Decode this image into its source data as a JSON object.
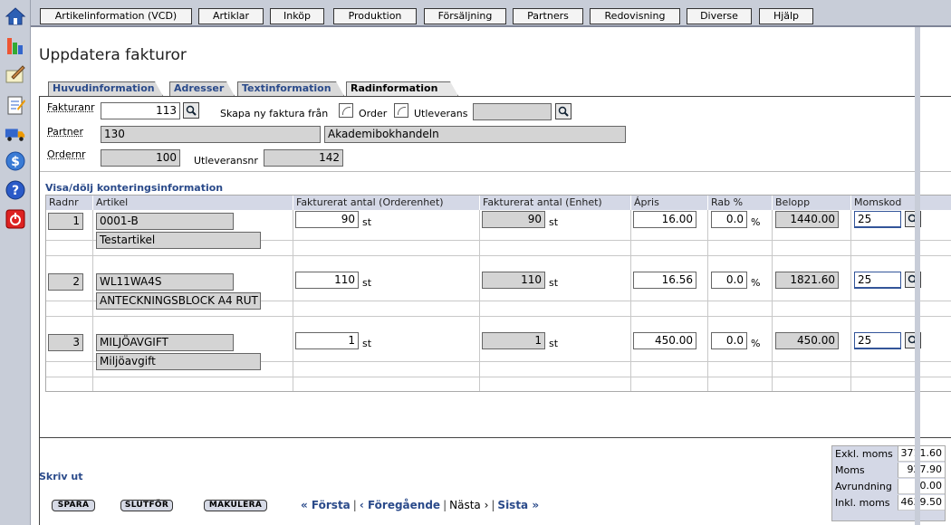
{
  "top_menu": [
    "Artikelinformation (VCD)",
    "Artiklar",
    "Inköp",
    "Produktion",
    "Försäljning",
    "Partners",
    "Redovisning",
    "Diverse",
    "Hjälp"
  ],
  "page_title": "Uppdatera fakturor",
  "sub_tabs": [
    "Huvudinformation",
    "Adresser",
    "Textinformation",
    "Radinformation"
  ],
  "header_form": {
    "fakturanr_label": "Fakturanr",
    "fakturanr_value": "113",
    "skapa_label": "Skapa ny faktura från",
    "order_label": "Order",
    "utleverans_label": "Utleverans",
    "utleverans_value": "",
    "partner_label": "Partner",
    "partner_code": "130",
    "partner_name": "Akademibokhandeln",
    "ordernr_label": "Ordernr",
    "ordernr_value": "100",
    "utleveransnr_label": "Utleveransnr",
    "utleveransnr_value": "142"
  },
  "toggle_label": "Visa/dölj konteringsinformation",
  "columns": [
    "Radnr",
    "Artikel",
    "Fakturerat antal (Orderenhet)",
    "Fakturerat antal (Enhet)",
    "Ápris",
    "Rab %",
    "Belopp",
    "Momskod"
  ],
  "rows": [
    {
      "radnr": "1",
      "artikel": "0001-B",
      "beskrivning": "Testartikel",
      "antal_order": "90",
      "unit1": "st",
      "antal_enhet": "90",
      "unit2": "st",
      "apris": "16.00",
      "rab": "0.0",
      "pct": "%",
      "belopp": "1440.00",
      "momskod": "25"
    },
    {
      "radnr": "2",
      "artikel": "WL11WA4S",
      "beskrivning": "ANTECKNINGSBLOCK A4 RUT",
      "antal_order": "110",
      "unit1": "st",
      "antal_enhet": "110",
      "unit2": "st",
      "apris": "16.56",
      "rab": "0.0",
      "pct": "%",
      "belopp": "1821.60",
      "momskod": "25"
    },
    {
      "radnr": "3",
      "artikel": "MILJÖAVGIFT",
      "beskrivning": "Miljöavgift",
      "antal_order": "1",
      "unit1": "st",
      "antal_enhet": "1",
      "unit2": "st",
      "apris": "450.00",
      "rab": "0.0",
      "pct": "%",
      "belopp": "450.00",
      "momskod": "25"
    }
  ],
  "print_label": "Skriv ut",
  "buttons": {
    "spara": "SPARA",
    "slutfor": "SLUTFÖR",
    "makulera": "MAKULERA"
  },
  "pager": {
    "forsta": "« Första",
    "foregaende": "‹ Föregående",
    "nasta": "Nästa ›",
    "sista": "Sista »",
    "sep": "|"
  },
  "totals": [
    {
      "label": "Exkl. moms",
      "value": "3711.60"
    },
    {
      "label": "Moms",
      "value": "927.90"
    },
    {
      "label": "Avrundning",
      "value": "0.00"
    },
    {
      "label": "Inkl. moms",
      "value": "4639.50"
    }
  ],
  "colors": {
    "accent": "#2a4a8a",
    "chrome": "#c8cdd8",
    "field_grey": "#d4d4d4",
    "header_bg": "#d4d8e6"
  }
}
